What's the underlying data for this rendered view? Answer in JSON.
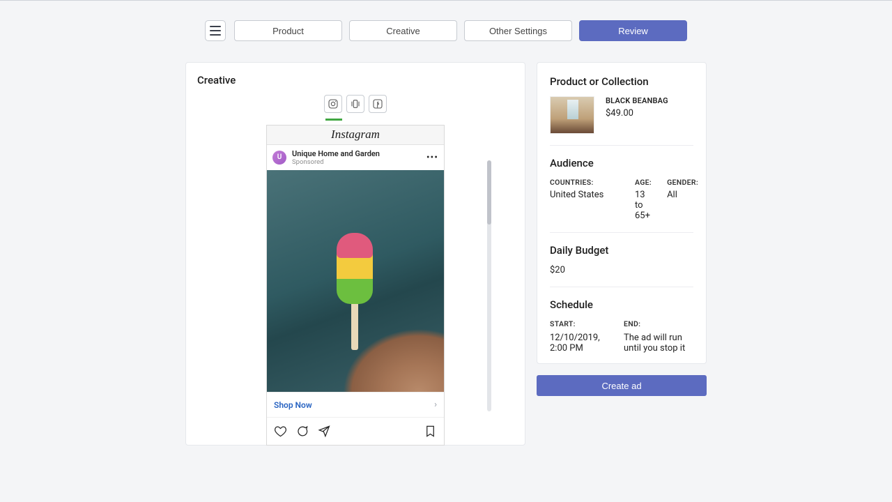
{
  "nav": {
    "tabs": [
      {
        "label": "Product"
      },
      {
        "label": "Creative"
      },
      {
        "label": "Other Settings"
      },
      {
        "label": "Review"
      }
    ]
  },
  "creative": {
    "title": "Creative",
    "platforms": {
      "instagram": "instagram-icon",
      "stories": "stories-icon",
      "facebook": "facebook-icon"
    },
    "preview": {
      "logo_text": "Instagram",
      "avatar_initial": "U",
      "page_name": "Unique Home and Garden",
      "sponsored_label": "Sponsored",
      "cta_label": "Shop Now"
    }
  },
  "summary": {
    "product_section_title": "Product or Collection",
    "product": {
      "name": "BLACK BEANBAG",
      "price": "$49.00"
    },
    "audience_title": "Audience",
    "audience": {
      "countries_label": "COUNTRIES:",
      "countries_value": "United States",
      "age_label": "AGE:",
      "age_value": "13 to 65+",
      "gender_label": "GENDER:",
      "gender_value": "All"
    },
    "budget_title": "Daily Budget",
    "budget_value": "$20",
    "schedule_title": "Schedule",
    "schedule": {
      "start_label": "START:",
      "start_value": "12/10/2019, 2:00 PM",
      "end_label": "END:",
      "end_value": "The ad will run until you stop it"
    },
    "create_label": "Create ad"
  }
}
